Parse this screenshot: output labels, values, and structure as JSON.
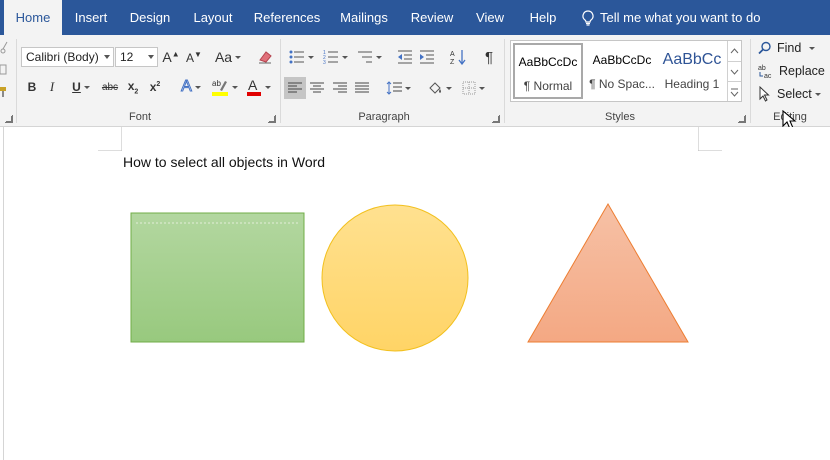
{
  "tabs": [
    {
      "label": "Home",
      "active": true
    },
    {
      "label": "Insert"
    },
    {
      "label": "Design"
    },
    {
      "label": "Layout"
    },
    {
      "label": "References"
    },
    {
      "label": "Mailings"
    },
    {
      "label": "Review"
    },
    {
      "label": "View"
    },
    {
      "label": "Help"
    }
  ],
  "tell_me": "Tell me what you want to do",
  "font_group": {
    "label": "Font",
    "font_name": "Calibri (Body)",
    "font_size": "12",
    "clear_format_glyph": "Aa"
  },
  "paragraph_group": {
    "label": "Paragraph"
  },
  "styles_group": {
    "label": "Styles",
    "items": [
      {
        "preview": "AaBbCcDc",
        "name": "¶ Normal"
      },
      {
        "preview": "AaBbCcDc",
        "name": "¶ No Spac..."
      },
      {
        "preview": "AaBbCc",
        "name": "Heading 1"
      }
    ]
  },
  "editing_group": {
    "label": "Editing",
    "find": "Find",
    "replace": "Replace",
    "select": "Select"
  },
  "document": {
    "title": "How to select all objects in Word"
  },
  "colors": {
    "accent": "#2b579a",
    "rect_fill": "#a8d08d",
    "rect_stroke": "#70ad47",
    "circle_fill": "#ffd966",
    "circle_stroke": "#f2c01e",
    "triangle_fill": "#f4b183",
    "triangle_stroke": "#ed7d31"
  }
}
